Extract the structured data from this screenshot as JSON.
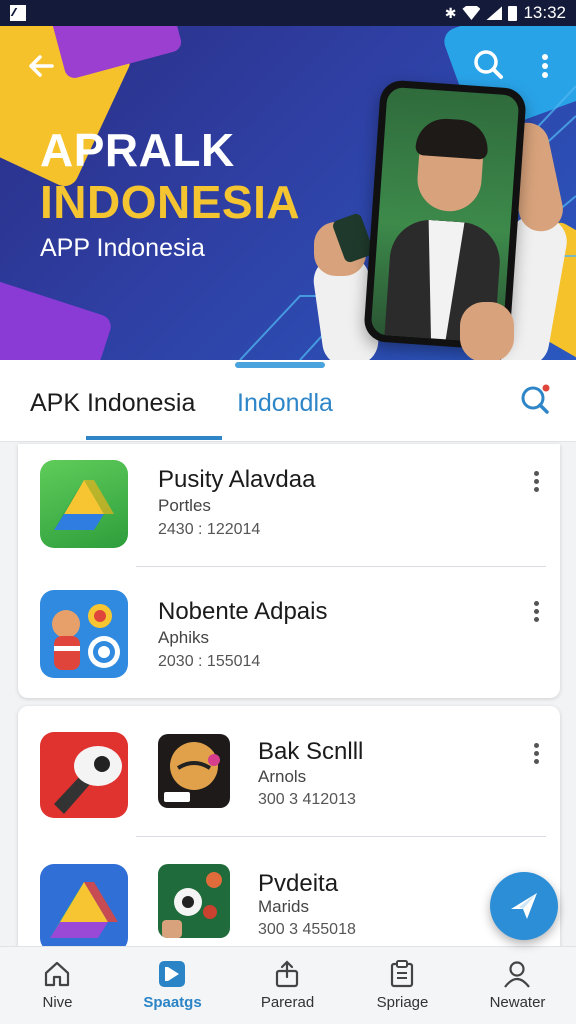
{
  "status_bar": {
    "time": "13:32"
  },
  "hero": {
    "title_line1": "APRALK",
    "title_line2": "INDONESIA",
    "subtitle": "APP Indonesia"
  },
  "tabs": [
    {
      "label": "APK Indonesia",
      "active": true
    },
    {
      "label": "Indondla",
      "active": false
    }
  ],
  "apps": [
    {
      "name": "Pusity Alavdaa",
      "developer": "Portles",
      "meta": "2430 : 122014",
      "icon": "google-drive-icon"
    },
    {
      "name": "Nobente Adpais",
      "developer": "Aphiks",
      "meta": "2030 : 155014",
      "icon": "character-target-icon"
    },
    {
      "name": "Bak Scnlll",
      "developer": "Arnols",
      "meta": "300 3 412013",
      "icon": "game-character-icon"
    },
    {
      "name": "Pvdeita",
      "developer": "Marids",
      "meta": "300 3 455018",
      "icon": "green-game-icon"
    }
  ],
  "side_icons": [
    {
      "icon": "red-camera-tool-icon"
    },
    {
      "icon": "drive-triangle-icon"
    }
  ],
  "bottom_nav": [
    {
      "label": "Nive",
      "icon": "home-icon",
      "active": false
    },
    {
      "label": "Spaatgs",
      "icon": "play-store-icon",
      "active": true
    },
    {
      "label": "Parerad",
      "icon": "upload-icon",
      "active": false
    },
    {
      "label": "Spriage",
      "icon": "clipboard-icon",
      "active": false
    },
    {
      "label": "Newater",
      "icon": "person-icon",
      "active": false
    }
  ],
  "colors": {
    "accent": "#2e86c8",
    "hero_yellow": "#f5c431",
    "hero_purple": "#9b3fd1",
    "hero_blue": "#2f3fa3"
  }
}
